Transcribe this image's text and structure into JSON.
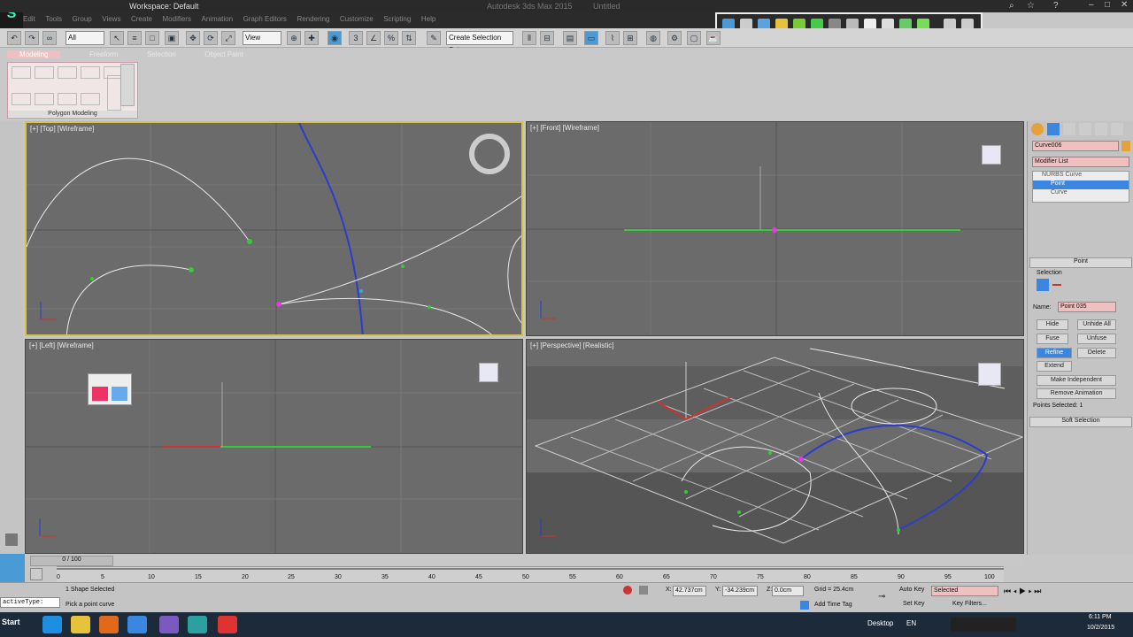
{
  "titlebar": {
    "workspace": "Workspace: Default",
    "app_title": "Autodesk 3ds Max 2015",
    "file_name": "Untitled"
  },
  "menubar": {
    "items": [
      "Edit",
      "Tools",
      "Group",
      "Views",
      "Create",
      "Modifiers",
      "Animation",
      "Graph Editors",
      "Rendering",
      "Customize",
      "Scripting",
      "Help"
    ]
  },
  "maintoolbar": {
    "selection_filter": "All",
    "coord_system": "View",
    "named_selection": "Create Selection Set"
  },
  "ribbon": {
    "tabs": [
      "Modeling",
      "Freeform",
      "Selection",
      "Object Paint"
    ],
    "panel_label": "Polygon Modeling"
  },
  "viewports": {
    "top": "[+] [Top] [Wireframe]",
    "front": "[+] [Front] [Wireframe]",
    "left": "[+] [Left] [Wireframe]",
    "perspective": "[+] [Perspective] [Realistic]"
  },
  "command_panel": {
    "object_name": "Curve006",
    "modifier_list": "Modifier List",
    "stack": [
      "NURBS Curve",
      "Point",
      "Curve"
    ],
    "rollout_point": "Point",
    "selection_label": "Selection",
    "name_label": "Name:",
    "name_value": "Point 035",
    "buttons": {
      "hide": "Hide",
      "unhide_all": "Unhide All",
      "fuse": "Fuse",
      "unfuse": "Unfuse",
      "refine": "Refine",
      "delete": "Delete",
      "extend": "Extend",
      "make_independent": "Make Independent",
      "remove_animation": "Remove Animation"
    },
    "points_selected": "Points Selected: 1",
    "soft_selection": "Soft Selection"
  },
  "timeline": {
    "frame": "0 / 100",
    "ticks": [
      "0",
      "5",
      "10",
      "15",
      "20",
      "25",
      "30",
      "35",
      "40",
      "45",
      "50",
      "55",
      "60",
      "65",
      "70",
      "75",
      "80",
      "85",
      "90",
      "95",
      "100"
    ]
  },
  "statusbar": {
    "selected": "1 Shape Selected",
    "prompt": "Pick a point curve",
    "x_label": "X:",
    "x_value": "42.737cm",
    "y_label": "Y:",
    "y_value": "-34.239cm",
    "z_label": "Z:",
    "z_value": "0.0cm",
    "grid": "Grid = 25.4cm",
    "add_time_tag": "Add Time Tag",
    "auto_key": "Auto Key",
    "auto_key_value": "Selected",
    "set_key": "Set Key",
    "key_filters": "Key Filters...",
    "maxscript": "activeType:"
  },
  "taskbar": {
    "start": "Start",
    "desktop": "Desktop",
    "lang": "EN",
    "time": "6:11 PM",
    "date": "10/2/2015"
  }
}
